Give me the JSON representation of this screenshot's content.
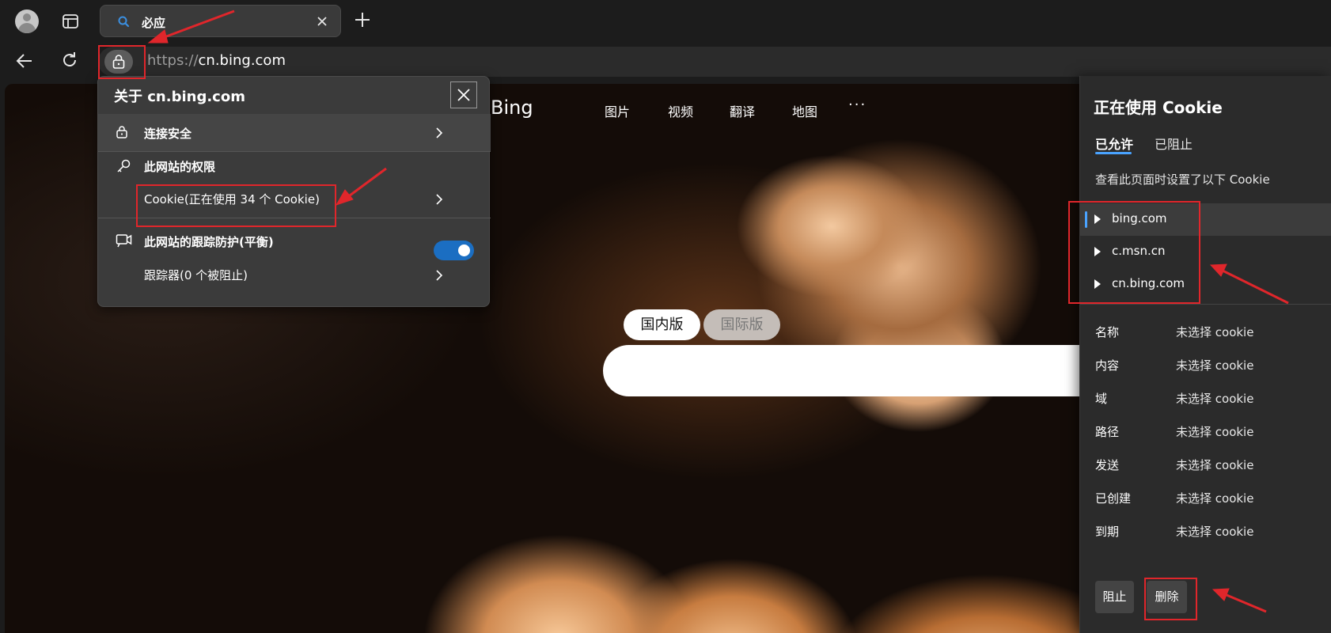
{
  "browser": {
    "tab": {
      "title": "必应"
    },
    "url": {
      "scheme": "https://",
      "host": "cn.bing.com"
    }
  },
  "page": {
    "logo": "Bing",
    "nav": [
      "图片",
      "视频",
      "翻译",
      "地图"
    ],
    "more": "···",
    "segments": {
      "domestic": "国内版",
      "international": "国际版"
    }
  },
  "site_info": {
    "title": "关于 cn.bing.com",
    "connection": "连接安全",
    "permissions_header": "此网站的权限",
    "cookie_item": "Cookie(正在使用 34 个 Cookie)",
    "tracking_header": "此网站的跟踪防护(平衡)",
    "tracking_enabled": true,
    "trackers": "跟踪器(0 个被阻止)"
  },
  "cookie_panel": {
    "title": "正在使用 Cookie",
    "tabs": {
      "allowed": "已允许",
      "blocked": "已阻止"
    },
    "description": "查看此页面时设置了以下 Cookie",
    "sites": [
      "bing.com",
      "c.msn.cn",
      "cn.bing.com"
    ],
    "properties": [
      {
        "name": "名称",
        "value": "未选择 cookie"
      },
      {
        "name": "内容",
        "value": "未选择 cookie"
      },
      {
        "name": "域",
        "value": "未选择 cookie"
      },
      {
        "name": "路径",
        "value": "未选择 cookie"
      },
      {
        "name": "发送",
        "value": "未选择 cookie"
      },
      {
        "name": "已创建",
        "value": "未选择 cookie"
      },
      {
        "name": "到期",
        "value": "未选择 cookie"
      }
    ],
    "buttons": {
      "block": "阻止",
      "delete": "删除"
    }
  },
  "colors": {
    "annotation_red": "#e0262b",
    "accent_blue": "#1b6ec2"
  }
}
